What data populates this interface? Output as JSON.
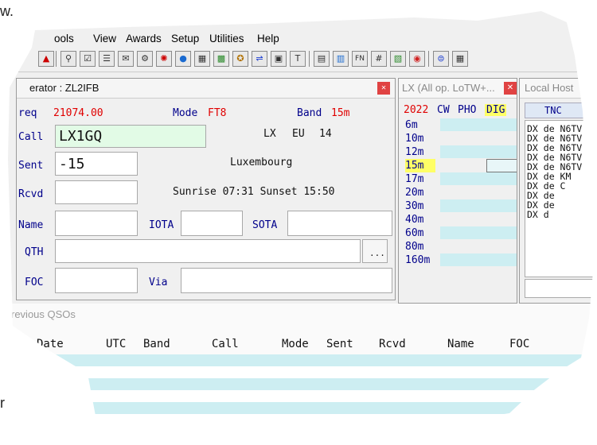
{
  "stray_text": {
    "top": "w.",
    "bottom": "r"
  },
  "menu": [
    "ools",
    "View",
    "Awards",
    "Setup",
    "Utilities",
    "Help"
  ],
  "toolbar_icons": [
    "antenna-icon",
    "callbook-icon",
    "checklist-icon",
    "log-icon",
    "qsl-icon",
    "rotor-icon",
    "bandmap-icon",
    "globe-icon",
    "grid-icon",
    "map-icon",
    "award-icon",
    "satellite-icon",
    "memory-icon",
    "text-icon",
    "tuner-icon",
    "dx-icon",
    "fn-icon",
    "hash-icon",
    "stats-icon",
    "ball-icon",
    "contest-icon",
    "more-icon"
  ],
  "log": {
    "title": "erator : ZL2IFB",
    "freq_label": "req",
    "freq_value": "21074.00",
    "mode_label": "Mode",
    "mode_value": "FT8",
    "band_label": "Band",
    "band_value": "15m",
    "call_label": "Call",
    "call_value": "LX1GQ",
    "prefix": "LX",
    "continent": "EU",
    "zone": "14",
    "sent_label": "Sent",
    "sent_value": "-15",
    "country": "Luxembourg",
    "rcvd_label": "Rcvd",
    "sun_times": "Sunrise 07:31 Sunset 15:50",
    "name_label": "Name",
    "iota_label": "IOTA",
    "sota_label": "SOTA",
    "qth_label": "QTH",
    "ellipsis": "...",
    "foc_label": "FOC",
    "via_label": "Via"
  },
  "band_window": {
    "title": "LX (All op. LoTW+...",
    "header": {
      "year": "2022",
      "cw": "CW",
      "pho": "PHO",
      "dig": "DIG"
    },
    "bands": [
      "6m",
      "10m",
      "12m",
      "15m",
      "17m",
      "20m",
      "30m",
      "40m",
      "60m",
      "80m",
      "160m"
    ],
    "selected_band": "15m",
    "highlight_color": "#ffff66"
  },
  "local_host": {
    "title": "Local Host",
    "tab": "TNC",
    "spots": [
      "DX de N6TV",
      "DX de N6TV",
      "DX de N6TV",
      "DX de N6TV",
      "DX de N6TV",
      "DX de KM",
      "DX de C",
      "DX de",
      "DX de",
      "DX d"
    ]
  },
  "previous": {
    "title": "revious QSOs",
    "columns": [
      "Date",
      "UTC",
      "Band",
      "Call",
      "Mode",
      "Sent",
      "Rcvd",
      "Name",
      "FOC"
    ]
  },
  "colors": {
    "label_blue": "#00008b",
    "value_red": "#e00000",
    "call_bg": "#e2fbe6",
    "row_cyan": "#cdeef2"
  }
}
